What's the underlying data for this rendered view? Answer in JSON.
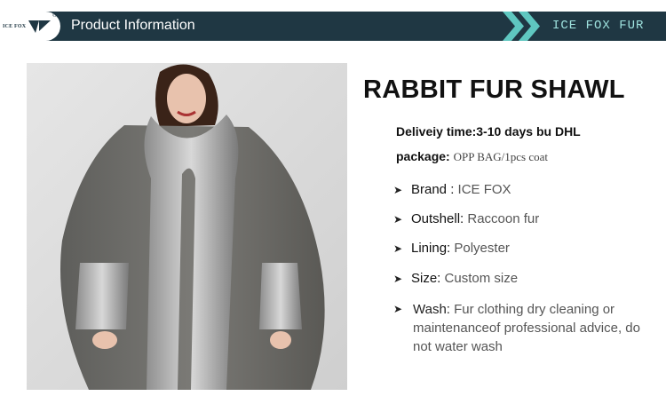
{
  "header": {
    "logo_text": "ICE FOX",
    "logo_reg": "®",
    "title": "Product Information",
    "brand_tag": "ICE FOX FUR"
  },
  "colors": {
    "header_bg": "#1f3743",
    "accent_teal": "#5fc7c0",
    "tag_text": "#9fe3df"
  },
  "product": {
    "title": "RABBIT FUR SHAWL",
    "delivery": "Deliveiy time:3-10 days bu DHL",
    "package_label": "package:",
    "package_value": "OPP BAG/1pcs coat",
    "specs": [
      {
        "label": "Brand :",
        "value": "ICE FOX"
      },
      {
        "label": "Outshell:",
        "value": "Raccoon fur"
      },
      {
        "label": "Lining:",
        "value": "Polyester"
      },
      {
        "label": "Size:",
        "value": "Custom size"
      }
    ],
    "wash_label": "Wash:",
    "wash_value": "Fur clothing dry cleaning or maintenanceof professional advice, do not water wash"
  },
  "icons": {
    "bullet": "arrow-bullet-icon",
    "header_chevrons": "double-chevron-icon"
  }
}
